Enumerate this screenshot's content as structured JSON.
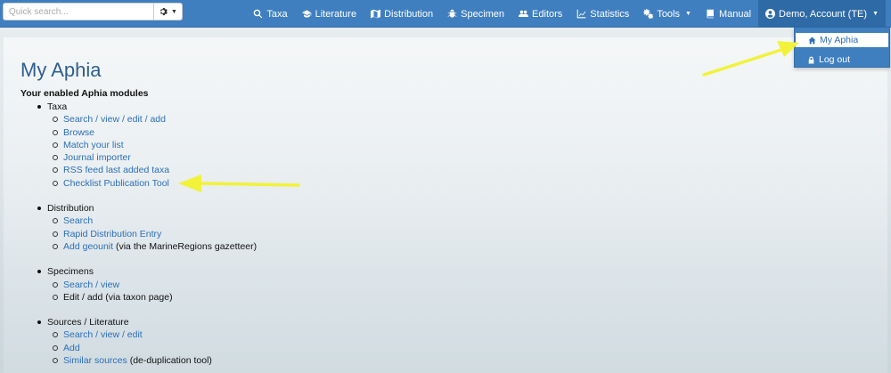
{
  "navbar": {
    "search_placeholder": "Quick search...",
    "search_options_icon": "gear-icon",
    "items": [
      {
        "label": "Taxa",
        "icon": "search-icon"
      },
      {
        "label": "Literature",
        "icon": "graduation-cap-icon"
      },
      {
        "label": "Distribution",
        "icon": "map-icon"
      },
      {
        "label": "Specimen",
        "icon": "bug-icon"
      },
      {
        "label": "Editors",
        "icon": "users-icon"
      },
      {
        "label": "Statistics",
        "icon": "line-chart-icon"
      },
      {
        "label": "Tools",
        "icon": "cogs-icon"
      },
      {
        "label": "Manual",
        "icon": "book-icon"
      },
      {
        "label": "Demo, Account (TE)",
        "icon": "user-circle-icon"
      }
    ]
  },
  "account_menu": {
    "items": [
      {
        "label": "My Aphia",
        "icon": "home-icon"
      },
      {
        "label": "Log out",
        "icon": "lock-icon"
      }
    ]
  },
  "page": {
    "title": "My Aphia",
    "subtitle": "Your enabled Aphia modules"
  },
  "modules": [
    {
      "title": "Taxa",
      "items": [
        {
          "link": "Search / view / edit / add",
          "text": ""
        },
        {
          "link": "Browse",
          "text": ""
        },
        {
          "link": "Match your list",
          "text": ""
        },
        {
          "link": "Journal importer",
          "text": ""
        },
        {
          "link": "RSS feed last added taxa",
          "text": ""
        },
        {
          "link": "Checklist Publication Tool",
          "text": ""
        }
      ]
    },
    {
      "title": "Distribution",
      "items": [
        {
          "link": "Search",
          "text": ""
        },
        {
          "link": "Rapid Distribution Entry",
          "text": ""
        },
        {
          "link": "Add geounit",
          "text": " (via the MarineRegions gazetteer)"
        }
      ]
    },
    {
      "title": "Specimens",
      "items": [
        {
          "link": "Search / view",
          "text": ""
        },
        {
          "link": "",
          "text": "Edit / add (via taxon page)"
        }
      ]
    },
    {
      "title": "Sources / Literature",
      "items": [
        {
          "link": "Search / view / edit",
          "text": ""
        },
        {
          "link": "Add",
          "text": ""
        },
        {
          "link": "Similar sources",
          "text": " (de-duplication tool)"
        }
      ]
    }
  ],
  "colors": {
    "navbar": "#3f7fbf",
    "link": "#2b6fb6",
    "annotation_arrow": "#f2f23a"
  }
}
